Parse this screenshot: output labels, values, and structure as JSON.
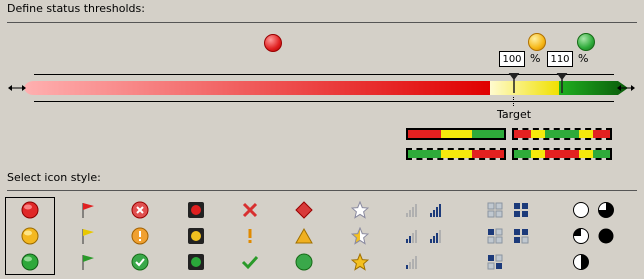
{
  "thresholds_section": {
    "title": "Define status thresholds:",
    "low_value": "100",
    "high_value": "110",
    "percent_symbol": "%",
    "target_label": "Target",
    "colors": {
      "red": "#e32020",
      "yellow": "#f5e90c",
      "green": "#2eab3a",
      "red_light": "#ff9a9a"
    }
  },
  "icon_section": {
    "title": "Select icon style:",
    "sets": [
      {
        "name": "circles",
        "icons": [
          "red-circle-icon",
          "yellow-circle-icon",
          "green-circle-icon"
        ],
        "selected": true
      },
      {
        "name": "flags",
        "icons": [
          "red-flag-icon",
          "yellow-flag-icon",
          "green-flag-icon"
        ],
        "selected": false
      },
      {
        "name": "symbols-circled",
        "icons": [
          "x-circle-icon",
          "exclamation-circle-icon",
          "check-circle-icon"
        ],
        "selected": false
      },
      {
        "name": "traffic-lights",
        "icons": [
          "red-light-icon",
          "yellow-light-icon",
          "green-light-icon"
        ],
        "selected": false
      },
      {
        "name": "symbols",
        "icons": [
          "x-icon",
          "exclamation-icon",
          "check-icon"
        ],
        "selected": false
      },
      {
        "name": "shapes",
        "icons": [
          "red-diamond-icon",
          "yellow-triangle-icon",
          "green-circle-icon"
        ],
        "selected": false
      },
      {
        "name": "stars",
        "icons": [
          "empty-star-icon",
          "half-star-icon",
          "full-star-icon"
        ],
        "selected": false
      },
      {
        "name": "signal-bars",
        "icons": [
          "signal-bars-icon",
          "signal-bars-icon",
          "signal-bars-icon"
        ],
        "selected": false
      },
      {
        "name": "quadrant-boxes",
        "icons": [
          "quadrant-boxes-icon",
          "quadrant-boxes-icon",
          "quadrant-boxes-icon"
        ],
        "selected": false
      },
      {
        "name": "pie-quarters",
        "icons": [
          "pie-icon",
          "pie-icon",
          "pie-icon"
        ],
        "selected": false
      }
    ]
  }
}
